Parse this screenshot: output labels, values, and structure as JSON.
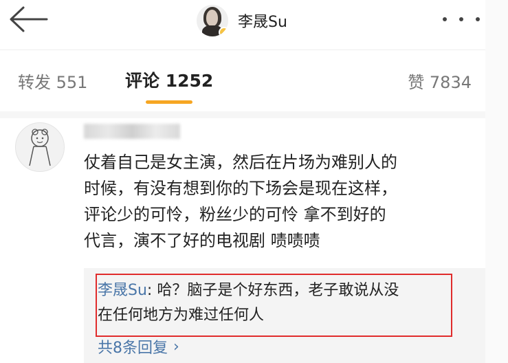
{
  "header": {
    "title": "李晟Su",
    "back_icon": "arrow-left-icon",
    "more_icon": "more-horizontal-icon",
    "verified_color": "#f6c343"
  },
  "tabs": {
    "repost": "转发 551",
    "comment": "评论 1252",
    "like": "赞 7834",
    "active": "comment",
    "accent": "#f6a623"
  },
  "comment": {
    "avatar_icon": "cartoon-avatar-icon",
    "lines": [
      "仗着自己是女主演，然后在片场为难别人的",
      "时候，有没有想到你的下场会是现在这样，",
      "评论少的可怜，粉丝少的可怜 拿不到好的",
      "代言，演不了好的电视剧 啧啧啧"
    ]
  },
  "reply": {
    "author": "李晟Su",
    "line1": ": 哈？脑子是个好东西，老子敢说从没",
    "line2": "在任何地方为难过任何人",
    "highlight_color": "#e02b2b",
    "link_color": "#4a76a8"
  },
  "more_replies": {
    "label": "共8条回复",
    "chevron": "›"
  }
}
